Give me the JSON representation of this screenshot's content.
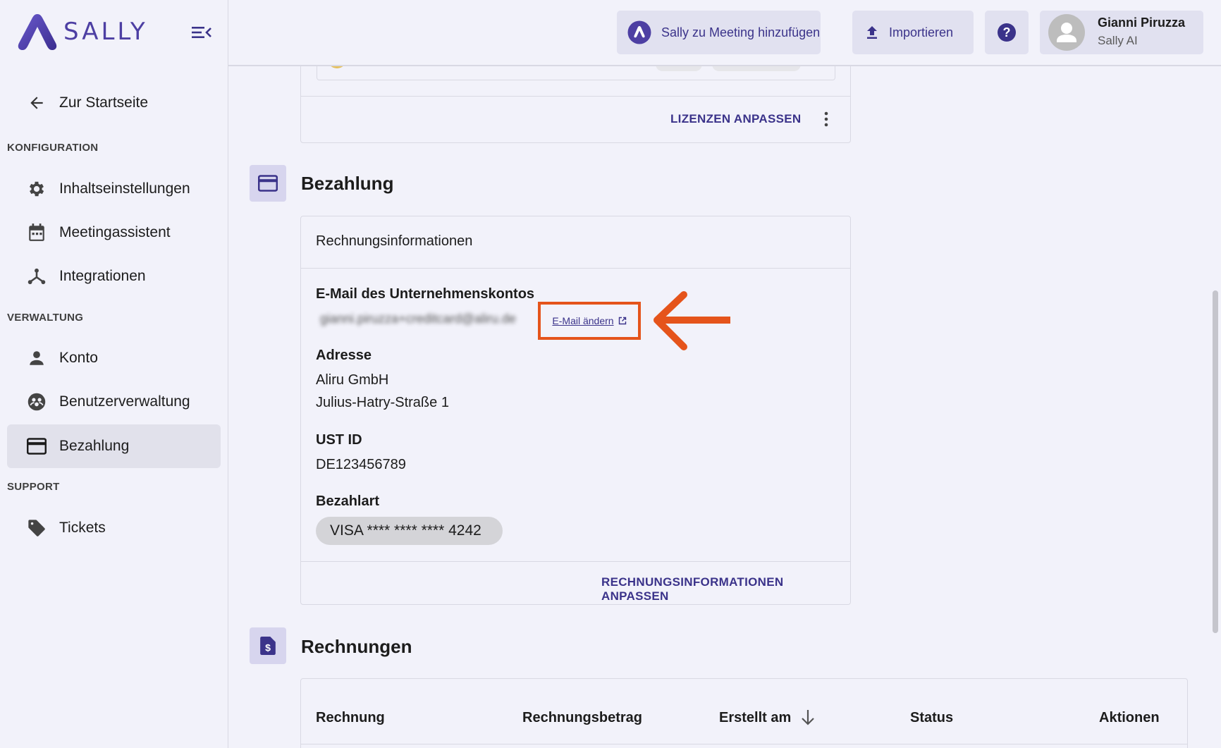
{
  "brand": {
    "name": "SALLY",
    "accent": "#4d3fa3",
    "highlight": "#e5541b"
  },
  "sidebar": {
    "back_label": "Zur Startseite",
    "sections": {
      "config": "KONFIGURATION",
      "admin": "VERWALTUNG",
      "support": "SUPPORT"
    },
    "items": {
      "content_settings": "Inhaltseinstellungen",
      "meeting_assistant": "Meetingassistent",
      "integrations": "Integrationen",
      "account": "Konto",
      "user_management": "Benutzerverwaltung",
      "billing": "Bezahlung",
      "tickets": "Tickets"
    },
    "active_item": "billing"
  },
  "topbar": {
    "add_to_meeting": "Sally zu Meeting hinzufügen",
    "import": "Importieren",
    "help_icon": "question-circle-icon",
    "user_name": "Gianni Piruzza",
    "user_org": "Sally AI"
  },
  "licenses": {
    "adjust_label": "LIZENZEN ANPASSEN"
  },
  "billing": {
    "title": "Bezahlung",
    "card_header": "Rechnungsinformationen",
    "email_label": "E-Mail des Unternehmenskontos",
    "email_value": "gianni.piruzza+creditcard@aliru.de",
    "email_change": "E-Mail ändern",
    "address_label": "Adresse",
    "address_line1": "Aliru GmbH",
    "address_line2": "Julius-Hatry-Straße 1",
    "vat_label": "UST ID",
    "vat_value": "DE123456789",
    "payment_label": "Bezahlart",
    "payment_value": "VISA **** **** **** 4242",
    "adjust_label": "RECHNUNGSINFORMATIONEN ANPASSEN"
  },
  "invoices": {
    "title": "Rechnungen",
    "columns": [
      "Rechnung",
      "Rechnungsbetrag",
      "Erstellt am",
      "Status",
      "Aktionen"
    ]
  }
}
